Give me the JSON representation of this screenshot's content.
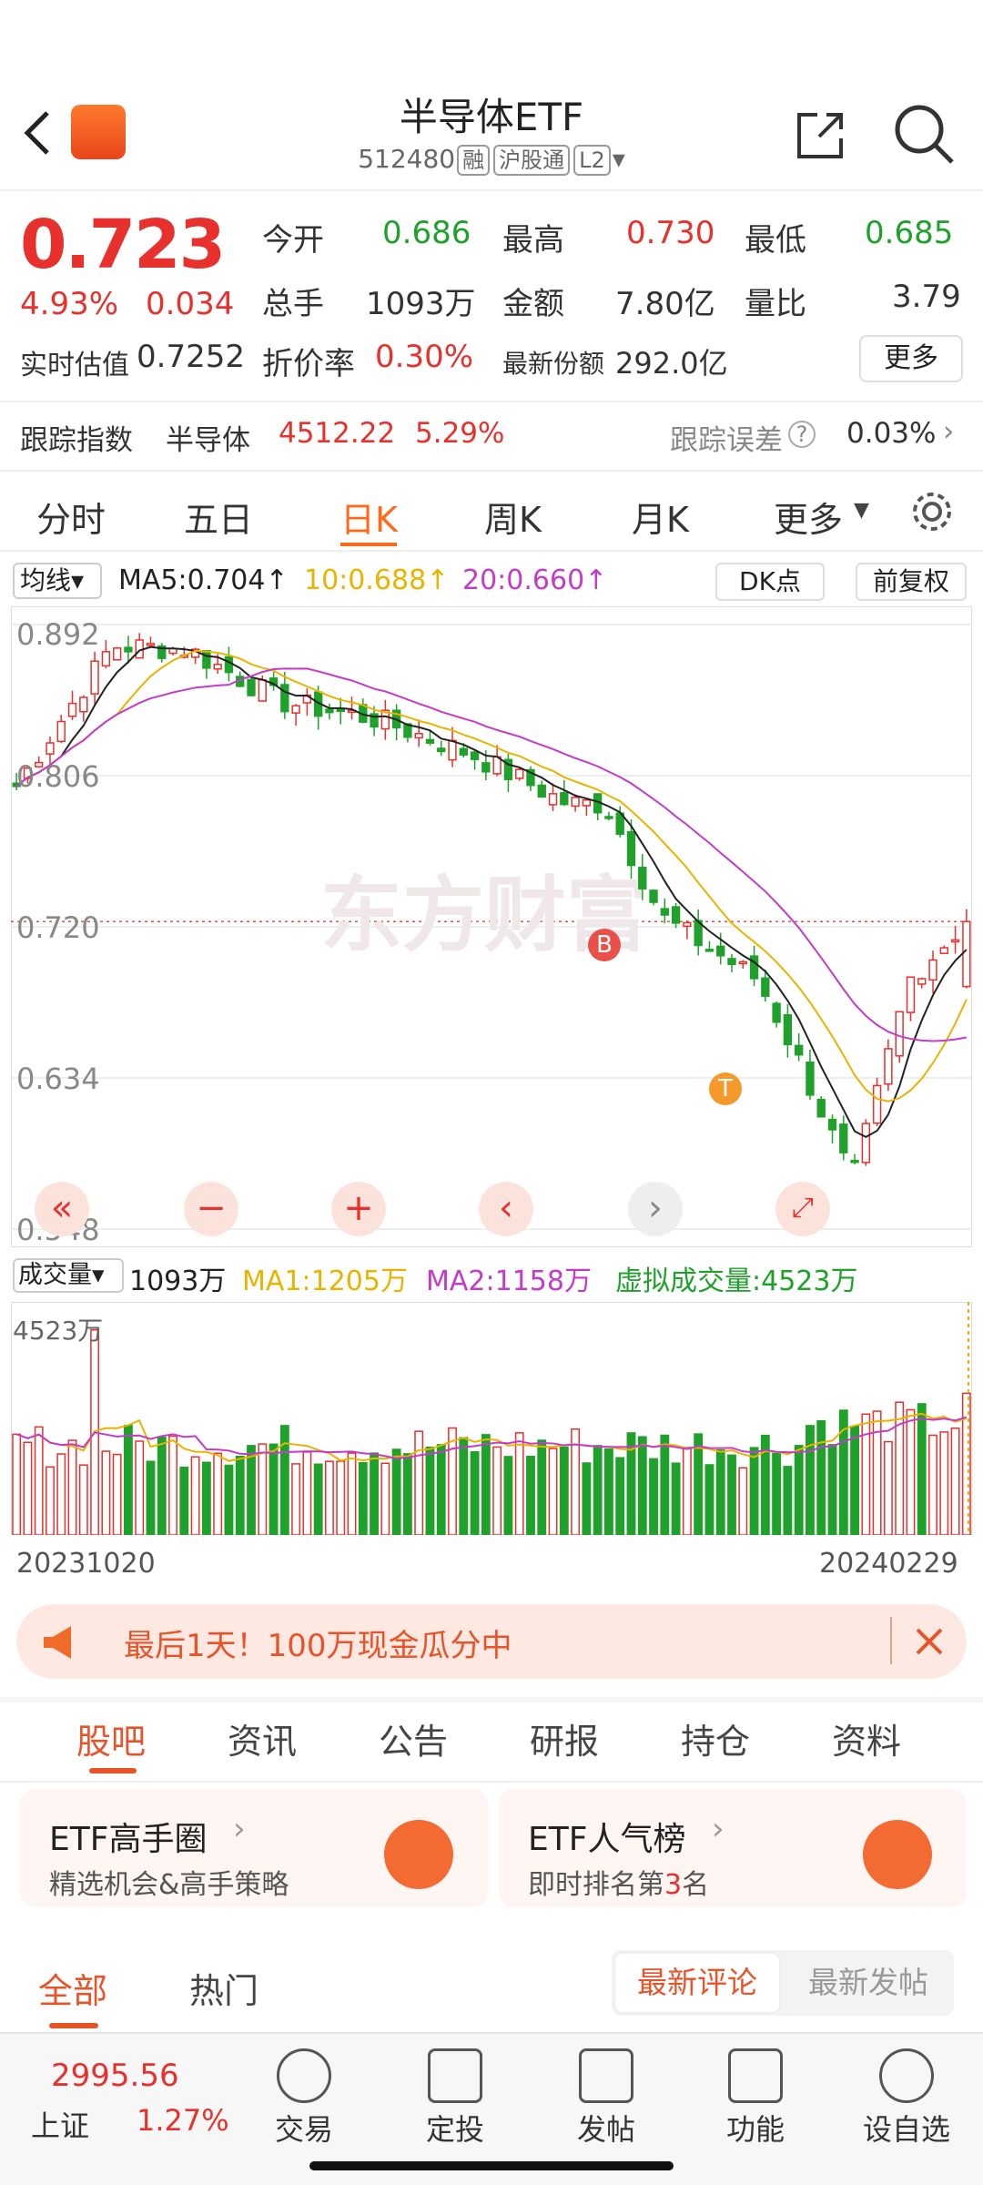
{
  "header": {
    "title": "半导体ETF",
    "code": "512480",
    "tags": [
      "融",
      "沪股通",
      "L2"
    ]
  },
  "quote": {
    "price": "0.723",
    "change_pct": "4.93%",
    "change": "0.034",
    "open_label": "今开",
    "open": "0.686",
    "high_label": "最高",
    "high": "0.730",
    "low_label": "最低",
    "low": "0.685",
    "vol_label": "总手",
    "vol": "1093万",
    "amount_label": "金额",
    "amount": "7.80亿",
    "ratio_label": "量比",
    "ratio": "3.79",
    "est_label": "实时估值",
    "est": "0.7252",
    "premium_label": "折价率",
    "premium": "0.30%",
    "share_label": "最新份额",
    "share": "292.0亿",
    "more": "更多"
  },
  "tracking": {
    "label": "跟踪指数",
    "index": "半导体",
    "value": "4512.22",
    "pct": "5.29%",
    "err_label": "跟踪误差",
    "err": "0.03%"
  },
  "tabs": [
    "分时",
    "五日",
    "日K",
    "周K",
    "月K",
    "更多"
  ],
  "active_tab": "日K",
  "ma_bar": {
    "type": "均线",
    "ma5": "MA5:0.704",
    "ma10": "10:0.688",
    "ma20": "20:0.660",
    "dk": "DK点",
    "fq": "前复权"
  },
  "price_axis": [
    "0.892",
    "0.806",
    "0.720",
    "0.634",
    "0.548"
  ],
  "watermark": "东方财富",
  "markers": {
    "b": "B",
    "t": "T"
  },
  "vol_bar": {
    "label": "成交量",
    "vol": "1093万",
    "ma1": "MA1:1205万",
    "ma2": "MA2:1158万",
    "virt": "虚拟成交量:4523万",
    "max": "4523万"
  },
  "date_range": {
    "start": "20231020",
    "end": "20240229"
  },
  "banner": {
    "text": "最后1天！100万现金瓜分中"
  },
  "section_tabs": [
    "股吧",
    "资讯",
    "公告",
    "研报",
    "持仓",
    "资料"
  ],
  "cards": [
    {
      "title": "ETF高手圈",
      "sub": "精选机会&高手策略"
    },
    {
      "title": "ETF人气榜",
      "sub_pre": "即时排名第",
      "sub_num": "3",
      "sub_post": "名"
    }
  ],
  "feed": {
    "tabs": [
      "全部",
      "热门"
    ],
    "sort": [
      "最新评论",
      "最新发帖"
    ]
  },
  "bottom": {
    "index_value": "2995.56",
    "index_name": "上证",
    "index_pct": "1.27%",
    "items": [
      "交易",
      "定投",
      "发帖",
      "功能",
      "设自选"
    ]
  },
  "chart_data": {
    "type": "candlestick",
    "x_range": [
      "20231020",
      "20240229"
    ],
    "ylim": [
      0.548,
      0.892
    ],
    "last": {
      "close": 0.723,
      "open": 0.686,
      "high": 0.73,
      "low": 0.685
    },
    "ma": {
      "MA5": 0.704,
      "MA10": 0.688,
      "MA20": 0.66
    },
    "volume": {
      "last": "1093万",
      "ma1": "1205万",
      "ma2": "1158万"
    }
  }
}
